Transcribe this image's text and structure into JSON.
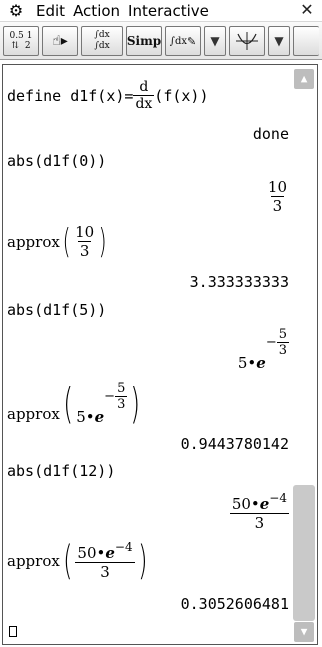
{
  "menubar": {
    "items": [
      "Edit",
      "Action",
      "Interactive"
    ]
  },
  "toolbar": {
    "simp_label": "Simp",
    "frac_num": "0.5",
    "frac_top": "1",
    "frac_bot": "2",
    "dfx_top": "∫dx",
    "dfx_bot": "∫dx",
    "ifdx_label": "∫dx"
  },
  "worksheet": {
    "l1_prefix": "define d1f(x)=",
    "l1_d": "d",
    "l1_dx": "dx",
    "l1_suffix": "(f(x))",
    "r1": "done",
    "l2": "abs(d1f(0))",
    "r2_num": "10",
    "r2_den": "3",
    "l3_fn": "approx",
    "l3_num": "10",
    "l3_den": "3",
    "r3": "3.333333333",
    "l4": "abs(d1f(5))",
    "r4_coef": "5•",
    "r4_e": "e",
    "r4_exp_sign": "−",
    "r4_exp_num": "5",
    "r4_exp_den": "3",
    "l5_fn": "approx",
    "l5_coef": "5•",
    "l5_e": "e",
    "l5_exp_sign": "−",
    "l5_exp_num": "5",
    "l5_exp_den": "3",
    "r5": "0.9443780142",
    "l6": "abs(d1f(12))",
    "r6_num_coef": "50•",
    "r6_e": "e",
    "r6_exp": "−4",
    "r6_den": "3",
    "l7_fn": "approx",
    "l7_num_coef": "50•",
    "l7_e": "e",
    "l7_exp": "−4",
    "l7_den": "3",
    "r7": "0.3052606481"
  }
}
